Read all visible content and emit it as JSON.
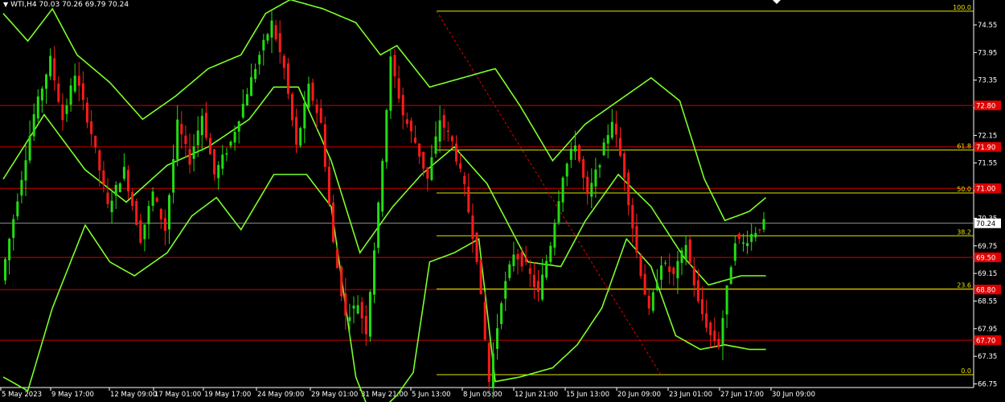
{
  "header": {
    "symbol": "WTI,H4",
    "ohlc": "70.03 70.26 69.79 70.24"
  },
  "chart_data": {
    "type": "candlestick",
    "symbol": "WTI",
    "timeframe": "H4",
    "last_price": "70.24",
    "y_range": [
      66.75,
      75.1
    ],
    "y_ticks": [
      "74.55",
      "73.95",
      "73.35",
      "72.75",
      "72.15",
      "71.55",
      "70.95",
      "70.35",
      "69.75",
      "69.15",
      "68.55",
      "67.95",
      "67.35",
      "66.75"
    ],
    "x_ticks": [
      "5 May 2023",
      "9 May 17:00",
      "12 May 09:00",
      "17 May 01:00",
      "19 May 17:00",
      "24 May 09:00",
      "29 May 01:00",
      "31 May 21:00",
      "5 Jun 13:00",
      "8 Jun 05:00",
      "12 Jun 21:00",
      "15 Jun 13:00",
      "20 Jun 09:00",
      "23 Jun 01:00",
      "27 Jun 17:00",
      "30 Jun 09:00"
    ],
    "horizontal_levels": [
      {
        "price": 72.8,
        "label": "72.80"
      },
      {
        "price": 71.9,
        "label": "71.90"
      },
      {
        "price": 71.0,
        "label": "71.00"
      },
      {
        "price": 69.5,
        "label": "69.50"
      },
      {
        "price": 68.8,
        "label": "68.80"
      },
      {
        "price": 67.7,
        "label": "67.70"
      }
    ],
    "fibonacci": {
      "high": 74.85,
      "low": 66.95,
      "levels": [
        {
          "ratio": 1.0,
          "label": "100.0"
        },
        {
          "ratio": 0.618,
          "label": "61.8"
        },
        {
          "ratio": 0.5,
          "label": "50.0"
        },
        {
          "ratio": 0.382,
          "label": "38.2"
        },
        {
          "ratio": 0.236,
          "label": "23.6"
        },
        {
          "ratio": 0.0,
          "label": "0.0"
        }
      ]
    },
    "price_path": [
      [
        0,
        69.0
      ],
      [
        4,
        70.8
      ],
      [
        8,
        72.6
      ],
      [
        12,
        73.8
      ],
      [
        15,
        72.5
      ],
      [
        18,
        73.5
      ],
      [
        22,
        72.2
      ],
      [
        26,
        70.6
      ],
      [
        30,
        71.4
      ],
      [
        34,
        69.9
      ],
      [
        37,
        70.9
      ],
      [
        40,
        70.1
      ],
      [
        43,
        72.4
      ],
      [
        46,
        71.6
      ],
      [
        49,
        72.6
      ],
      [
        52,
        71.3
      ],
      [
        56,
        72.0
      ],
      [
        60,
        73.1
      ],
      [
        63,
        73.9
      ],
      [
        66,
        74.6
      ],
      [
        69,
        73.6
      ],
      [
        72,
        71.9
      ],
      [
        75,
        73.2
      ],
      [
        78,
        72.4
      ],
      [
        81,
        69.8
      ],
      [
        84,
        68.2
      ],
      [
        87,
        68.5
      ],
      [
        89,
        67.9
      ],
      [
        92,
        70.6
      ],
      [
        95,
        73.8
      ],
      [
        98,
        72.6
      ],
      [
        101,
        72.0
      ],
      [
        104,
        71.2
      ],
      [
        107,
        72.5
      ],
      [
        110,
        72.0
      ],
      [
        113,
        71.0
      ],
      [
        116,
        69.5
      ],
      [
        119,
        66.8
      ],
      [
        122,
        68.6
      ],
      [
        125,
        69.6
      ],
      [
        128,
        69.3
      ],
      [
        131,
        68.7
      ],
      [
        134,
        69.8
      ],
      [
        137,
        71.3
      ],
      [
        140,
        72.0
      ],
      [
        143,
        70.8
      ],
      [
        146,
        71.6
      ],
      [
        149,
        72.5
      ],
      [
        152,
        71.3
      ],
      [
        155,
        69.6
      ],
      [
        158,
        68.3
      ],
      [
        161,
        69.4
      ],
      [
        164,
        69.1
      ],
      [
        167,
        69.8
      ],
      [
        170,
        68.5
      ],
      [
        173,
        67.8
      ],
      [
        175,
        67.6
      ],
      [
        177,
        68.8
      ],
      [
        179,
        69.9
      ],
      [
        181,
        69.8
      ],
      [
        183,
        70.0
      ],
      [
        186,
        70.24
      ]
    ],
    "bollinger": {
      "middle": [
        [
          0,
          71.2
        ],
        [
          10,
          72.6
        ],
        [
          20,
          71.4
        ],
        [
          30,
          70.7
        ],
        [
          40,
          71.5
        ],
        [
          50,
          71.9
        ],
        [
          60,
          72.5
        ],
        [
          66,
          73.2
        ],
        [
          72,
          73.2
        ],
        [
          80,
          71.6
        ],
        [
          87,
          69.6
        ],
        [
          95,
          70.6
        ],
        [
          102,
          71.3
        ],
        [
          110,
          71.9
        ],
        [
          118,
          71.1
        ],
        [
          128,
          69.4
        ],
        [
          136,
          69.3
        ],
        [
          142,
          70.3
        ],
        [
          150,
          71.3
        ],
        [
          158,
          70.6
        ],
        [
          166,
          69.5
        ],
        [
          172,
          68.9
        ],
        [
          180,
          69.1
        ],
        [
          186,
          69.1
        ]
      ],
      "upper": [
        [
          0,
          74.8
        ],
        [
          6,
          74.2
        ],
        [
          12,
          74.9
        ],
        [
          18,
          73.9
        ],
        [
          26,
          73.3
        ],
        [
          34,
          72.5
        ],
        [
          42,
          73.0
        ],
        [
          50,
          73.6
        ],
        [
          58,
          73.9
        ],
        [
          64,
          74.8
        ],
        [
          70,
          75.1
        ],
        [
          78,
          74.9
        ],
        [
          86,
          74.6
        ],
        [
          92,
          73.9
        ],
        [
          96,
          74.1
        ],
        [
          104,
          73.2
        ],
        [
          112,
          73.4
        ],
        [
          120,
          73.6
        ],
        [
          126,
          72.8
        ],
        [
          134,
          71.6
        ],
        [
          142,
          72.4
        ],
        [
          150,
          72.9
        ],
        [
          158,
          73.4
        ],
        [
          165,
          72.9
        ],
        [
          171,
          71.2
        ],
        [
          176,
          70.3
        ],
        [
          182,
          70.5
        ],
        [
          186,
          70.8
        ]
      ],
      "lower": [
        [
          0,
          66.9
        ],
        [
          6,
          66.6
        ],
        [
          12,
          68.4
        ],
        [
          20,
          70.2
        ],
        [
          26,
          69.4
        ],
        [
          32,
          69.1
        ],
        [
          40,
          69.6
        ],
        [
          46,
          70.4
        ],
        [
          52,
          70.8
        ],
        [
          58,
          70.1
        ],
        [
          66,
          71.3
        ],
        [
          74,
          71.3
        ],
        [
          80,
          70.6
        ],
        [
          86,
          66.9
        ],
        [
          90,
          66.0
        ],
        [
          96,
          66.5
        ],
        [
          100,
          67.0
        ],
        [
          104,
          69.4
        ],
        [
          110,
          69.6
        ],
        [
          116,
          69.9
        ],
        [
          120,
          66.8
        ],
        [
          126,
          66.9
        ],
        [
          134,
          67.1
        ],
        [
          140,
          67.6
        ],
        [
          146,
          68.4
        ],
        [
          152,
          69.9
        ],
        [
          158,
          69.3
        ],
        [
          164,
          67.8
        ],
        [
          170,
          67.5
        ],
        [
          176,
          67.6
        ],
        [
          182,
          67.5
        ],
        [
          186,
          67.5
        ]
      ]
    }
  }
}
